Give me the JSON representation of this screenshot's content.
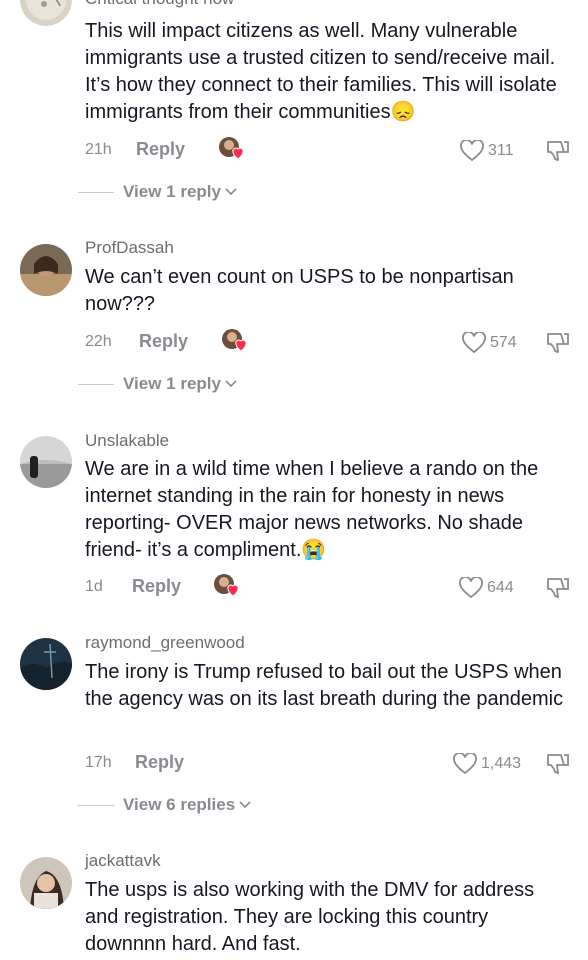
{
  "comments": [
    {
      "username": "Critical thought now",
      "text": "This will impact citizens as well. Many vulnerable immigrants use a trusted citizen to send/receive mail. It’s how they connect to their families. This will isolate immigrants from their communities😞",
      "time": "21h",
      "reply_label": "Reply",
      "likes": "311",
      "view_replies": "View 1 reply"
    },
    {
      "username": "ProfDassah",
      "text": "We can’t even count on USPS to be nonpartisan now???",
      "time": "22h",
      "reply_label": "Reply",
      "likes": "574",
      "view_replies": "View 1 reply"
    },
    {
      "username": "Unslakable",
      "text": "We are in a wild time when I believe a rando on the internet standing in the rain for honesty in news reporting- OVER major news networks. No shade friend- it’s a compliment.😭",
      "time": "1d",
      "reply_label": "Reply",
      "likes": "644"
    },
    {
      "username": "raymond_greenwood",
      "text": "The irony is Trump refused to bail out the USPS when the agency was on its last breath during the pandemic",
      "time": "17h",
      "reply_label": "Reply",
      "likes": "1,443",
      "view_replies": "View 6 replies"
    },
    {
      "username": "jackattavk",
      "text": "The usps is also working with the DMV for address and registration. They are locking this country downnnn hard. And fast."
    }
  ]
}
